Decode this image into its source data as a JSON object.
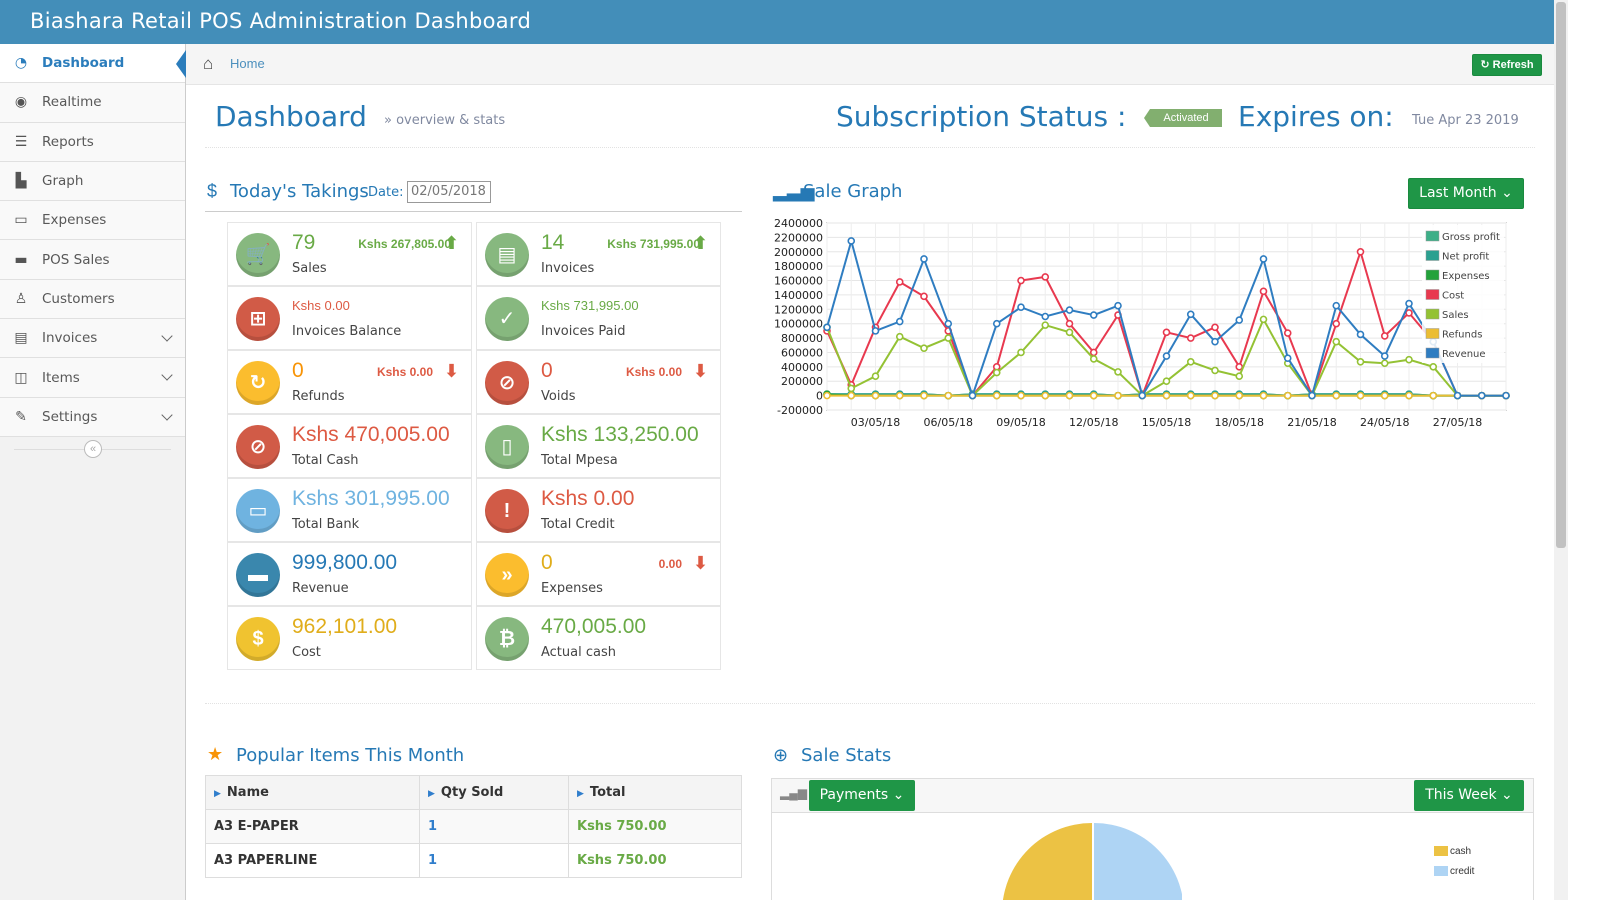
{
  "app": {
    "title": "Biashara Retail POS Administration Dashboard"
  },
  "sidebar": {
    "items": [
      {
        "label": "Dashboard",
        "icon": "tachometer-icon",
        "active": true
      },
      {
        "label": "Realtime",
        "icon": "eye-icon"
      },
      {
        "label": "Reports",
        "icon": "list-ol-icon"
      },
      {
        "label": "Graph",
        "icon": "bar-chart-icon"
      },
      {
        "label": "Expenses",
        "icon": "credit-card-icon"
      },
      {
        "label": "POS Sales",
        "icon": "briefcase-icon"
      },
      {
        "label": "Customers",
        "icon": "user-icon"
      },
      {
        "label": "Invoices",
        "icon": "file-icon",
        "expandable": true
      },
      {
        "label": "Items",
        "icon": "cube-icon",
        "expandable": true
      },
      {
        "label": "Settings",
        "icon": "edit-icon",
        "expandable": true
      }
    ],
    "collapse_icon": "double-chevron-left-icon"
  },
  "breadcrumbs": {
    "home": "Home",
    "refresh": "Refresh"
  },
  "header": {
    "title": "Dashboard",
    "subtitle": "overview & stats",
    "subscription_label": "Subscription Status :",
    "subscription_status": "Activated",
    "expires_label": "Expires on:",
    "expires_date": "Tue Apr 23 2019"
  },
  "takings": {
    "title": "Today's Takings",
    "date_label": "Date:",
    "date_value": "02/05/2018",
    "cells": [
      {
        "value": "79",
        "label": "Sales",
        "trend": "Kshs 267,805.00",
        "trend_dir": "up",
        "icon": "shopping-cart-icon",
        "color": "green"
      },
      {
        "value": "14",
        "label": "Invoices",
        "trend": "Kshs 731,995.00",
        "trend_dir": "up",
        "icon": "clipboard-icon",
        "color": "green"
      },
      {
        "value": "Kshs 0.00",
        "label": "Invoices Balance",
        "icon": "file-plus-icon",
        "color": "red"
      },
      {
        "value": "Kshs 731,995.00",
        "label": "Invoices Paid",
        "icon": "check-file-icon",
        "color": "green"
      },
      {
        "value": "0",
        "label": "Refunds",
        "trend": "Kshs 0.00",
        "trend_dir": "down",
        "icon": "refresh-icon",
        "color": "orange"
      },
      {
        "value": "0",
        "label": "Voids",
        "trend": "Kshs 0.00",
        "trend_dir": "down",
        "icon": "ban-icon",
        "color": "red"
      },
      {
        "value": "Kshs 470,005.00",
        "label": "Total Cash",
        "icon": "ban-icon",
        "color": "red"
      },
      {
        "value": "Kshs 133,250.00",
        "label": "Total Mpesa",
        "icon": "mobile-icon",
        "color": "green"
      },
      {
        "value": "Kshs 301,995.00",
        "label": "Total Bank",
        "icon": "credit-card-icon",
        "color": "blue"
      },
      {
        "value": "Kshs 0.00",
        "label": "Total Credit",
        "icon": "exclamation-icon",
        "color": "red"
      },
      {
        "value": "999,800.00",
        "label": "Revenue",
        "icon": "briefcase-icon",
        "color": "darkblue"
      },
      {
        "value": "0",
        "label": "Expenses",
        "trend": "0.00",
        "trend_dir": "down",
        "icon": "fast-forward-icon",
        "color": "yellow"
      },
      {
        "value": "962,101.00",
        "label": "Cost",
        "icon": "dollar-icon",
        "color": "gold"
      },
      {
        "value": "470,005.00",
        "label": "Actual cash",
        "icon": "bitcoin-icon",
        "color": "green"
      }
    ]
  },
  "sale_graph": {
    "title": "Sale Graph",
    "range_button": "Last Month"
  },
  "chart_data": {
    "type": "line",
    "x": [
      "01/05/18",
      "02/05/18",
      "03/05/18",
      "04/05/18",
      "05/05/18",
      "06/05/18",
      "07/05/18",
      "08/05/18",
      "09/05/18",
      "10/05/18",
      "11/05/18",
      "12/05/18",
      "13/05/18",
      "14/05/18",
      "15/05/18",
      "16/05/18",
      "17/05/18",
      "18/05/18",
      "19/05/18",
      "20/05/18",
      "21/05/18",
      "22/05/18",
      "23/05/18",
      "24/05/18",
      "25/05/18",
      "26/05/18",
      "27/05/18",
      "28/05/18",
      "29/05/18"
    ],
    "xtick_labels": [
      "03/05/18",
      "06/05/18",
      "09/05/18",
      "12/05/18",
      "15/05/18",
      "18/05/18",
      "21/05/18",
      "24/05/18",
      "27/05/18"
    ],
    "ylim": [
      -200000,
      2400000
    ],
    "yticks": [
      -200000,
      0,
      200000,
      400000,
      600000,
      800000,
      1000000,
      1200000,
      1400000,
      1600000,
      1800000,
      2000000,
      2200000,
      2400000
    ],
    "grid": true,
    "legend_position": "top-right",
    "series": [
      {
        "name": "Gross profit",
        "color": "#3daf88",
        "values": [
          20000,
          20000,
          20000,
          20000,
          20000,
          0,
          20000,
          20000,
          20000,
          20000,
          20000,
          20000,
          0,
          20000,
          20000,
          20000,
          20000,
          20000,
          20000,
          0,
          20000,
          20000,
          20000,
          20000,
          20000,
          0,
          0,
          0,
          0
        ]
      },
      {
        "name": "Net profit",
        "color": "#2ba090",
        "values": [
          20000,
          20000,
          20000,
          20000,
          20000,
          0,
          20000,
          20000,
          20000,
          20000,
          20000,
          20000,
          0,
          20000,
          20000,
          20000,
          20000,
          20000,
          20000,
          0,
          20000,
          20000,
          20000,
          20000,
          20000,
          0,
          0,
          0,
          0
        ]
      },
      {
        "name": "Expenses",
        "color": "#23a23a",
        "values": [
          20000,
          0,
          0,
          0,
          0,
          0,
          0,
          0,
          0,
          0,
          0,
          0,
          0,
          0,
          0,
          0,
          0,
          0,
          0,
          0,
          0,
          0,
          0,
          0,
          0,
          0,
          0,
          0,
          0
        ]
      },
      {
        "name": "Cost",
        "color": "#e8394f",
        "values": [
          900000,
          150000,
          950000,
          1580000,
          1380000,
          900000,
          0,
          400000,
          1600000,
          1650000,
          1000000,
          600000,
          1120000,
          0,
          880000,
          800000,
          950000,
          400000,
          1450000,
          870000,
          0,
          1000000,
          2000000,
          830000,
          1150000,
          750000,
          0,
          0,
          0
        ]
      },
      {
        "name": "Sales",
        "color": "#94c234",
        "values": [
          950000,
          100000,
          270000,
          820000,
          660000,
          800000,
          0,
          320000,
          600000,
          980000,
          880000,
          510000,
          330000,
          0,
          200000,
          470000,
          350000,
          270000,
          1060000,
          450000,
          0,
          750000,
          470000,
          450000,
          500000,
          400000,
          0,
          0,
          0
        ]
      },
      {
        "name": "Refunds",
        "color": "#ebbd33",
        "values": [
          0,
          0,
          0,
          0,
          0,
          0,
          0,
          0,
          0,
          0,
          0,
          0,
          0,
          0,
          0,
          0,
          0,
          0,
          0,
          0,
          0,
          0,
          0,
          0,
          0,
          0,
          0,
          0,
          0
        ]
      },
      {
        "name": "Revenue",
        "color": "#2f7dc1",
        "values": [
          950000,
          2150000,
          900000,
          1030000,
          1900000,
          1000000,
          0,
          1000000,
          1230000,
          1100000,
          1190000,
          1120000,
          1250000,
          0,
          550000,
          1130000,
          750000,
          1050000,
          1900000,
          520000,
          0,
          1250000,
          850000,
          550000,
          1280000,
          750000,
          0,
          0,
          0
        ]
      }
    ]
  },
  "popular": {
    "title": "Popular Items This Month",
    "columns": [
      "Name",
      "Qty Sold",
      "Total"
    ],
    "rows": [
      {
        "name": "A3 E-PAPER",
        "qty": "1",
        "total": "Kshs 750.00"
      },
      {
        "name": "A3 PAPERLINE",
        "qty": "1",
        "total": "Kshs 750.00"
      }
    ]
  },
  "sale_stats": {
    "title": "Sale Stats",
    "type_button": "Payments",
    "range_button": "This Week",
    "legend": [
      {
        "label": "cash",
        "color": "#ecc244"
      },
      {
        "label": "credit",
        "color": "#aed4f4"
      }
    ]
  },
  "colors": {
    "brand": "#438eb9",
    "accent": "#2679b5",
    "button": "#1f9647"
  }
}
